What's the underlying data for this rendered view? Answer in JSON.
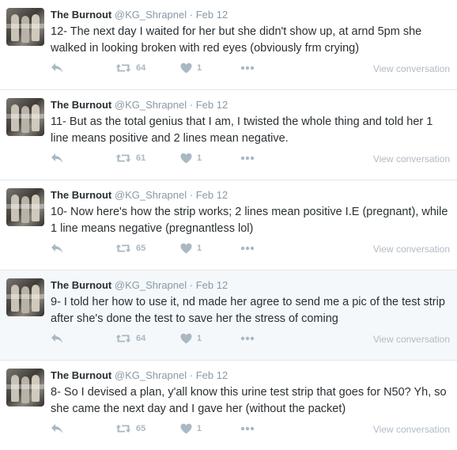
{
  "colors": {
    "name": "#292f33",
    "meta": "#8899a6",
    "icon": "#aab8c2",
    "divider": "#e1e8ed",
    "highlight_background": "#f5f8fa"
  },
  "icons": {
    "reply": "reply-arrow-icon",
    "retweet": "retweet-icon",
    "like": "heart-icon",
    "more": "more-dots-icon"
  },
  "tweets": [
    {
      "name": "The Burnout",
      "handle": "@KG_Shrapnel",
      "separator": "·",
      "date": "Feb 12",
      "text": "12- The next day I waited for her but she didn't show up, at arnd 5pm she walked in looking broken with red eyes (obviously frm crying)",
      "retweets": "64",
      "likes": "1",
      "view_conversation": "View conversation",
      "highlighted": false
    },
    {
      "name": "The Burnout",
      "handle": "@KG_Shrapnel",
      "separator": "·",
      "date": "Feb 12",
      "text": "11- But as the total genius that I am, I twisted the whole thing and told her 1 line means positive and 2 lines mean negative.",
      "retweets": "61",
      "likes": "1",
      "view_conversation": "View conversation",
      "highlighted": false
    },
    {
      "name": "The Burnout",
      "handle": "@KG_Shrapnel",
      "separator": "·",
      "date": "Feb 12",
      "text": "10- Now here's how the strip works; 2 lines mean positive I.E (pregnant), while 1 line means negative (pregnantless lol)",
      "retweets": "65",
      "likes": "1",
      "view_conversation": "View conversation",
      "highlighted": false
    },
    {
      "name": "The Burnout",
      "handle": "@KG_Shrapnel",
      "separator": "·",
      "date": "Feb 12",
      "text": "9- I told her how to use it, nd made her agree to send me a pic of the test strip after she's done the test to save her the stress of coming",
      "retweets": "64",
      "likes": "1",
      "view_conversation": "View conversation",
      "highlighted": true
    },
    {
      "name": "The Burnout",
      "handle": "@KG_Shrapnel",
      "separator": "·",
      "date": "Feb 12",
      "text": "8- So I devised a plan, y'all know this urine test strip that goes for N50? Yh, so she came the next day and I gave her (without the packet)",
      "retweets": "65",
      "likes": "1",
      "view_conversation": "View conversation",
      "highlighted": false
    }
  ]
}
